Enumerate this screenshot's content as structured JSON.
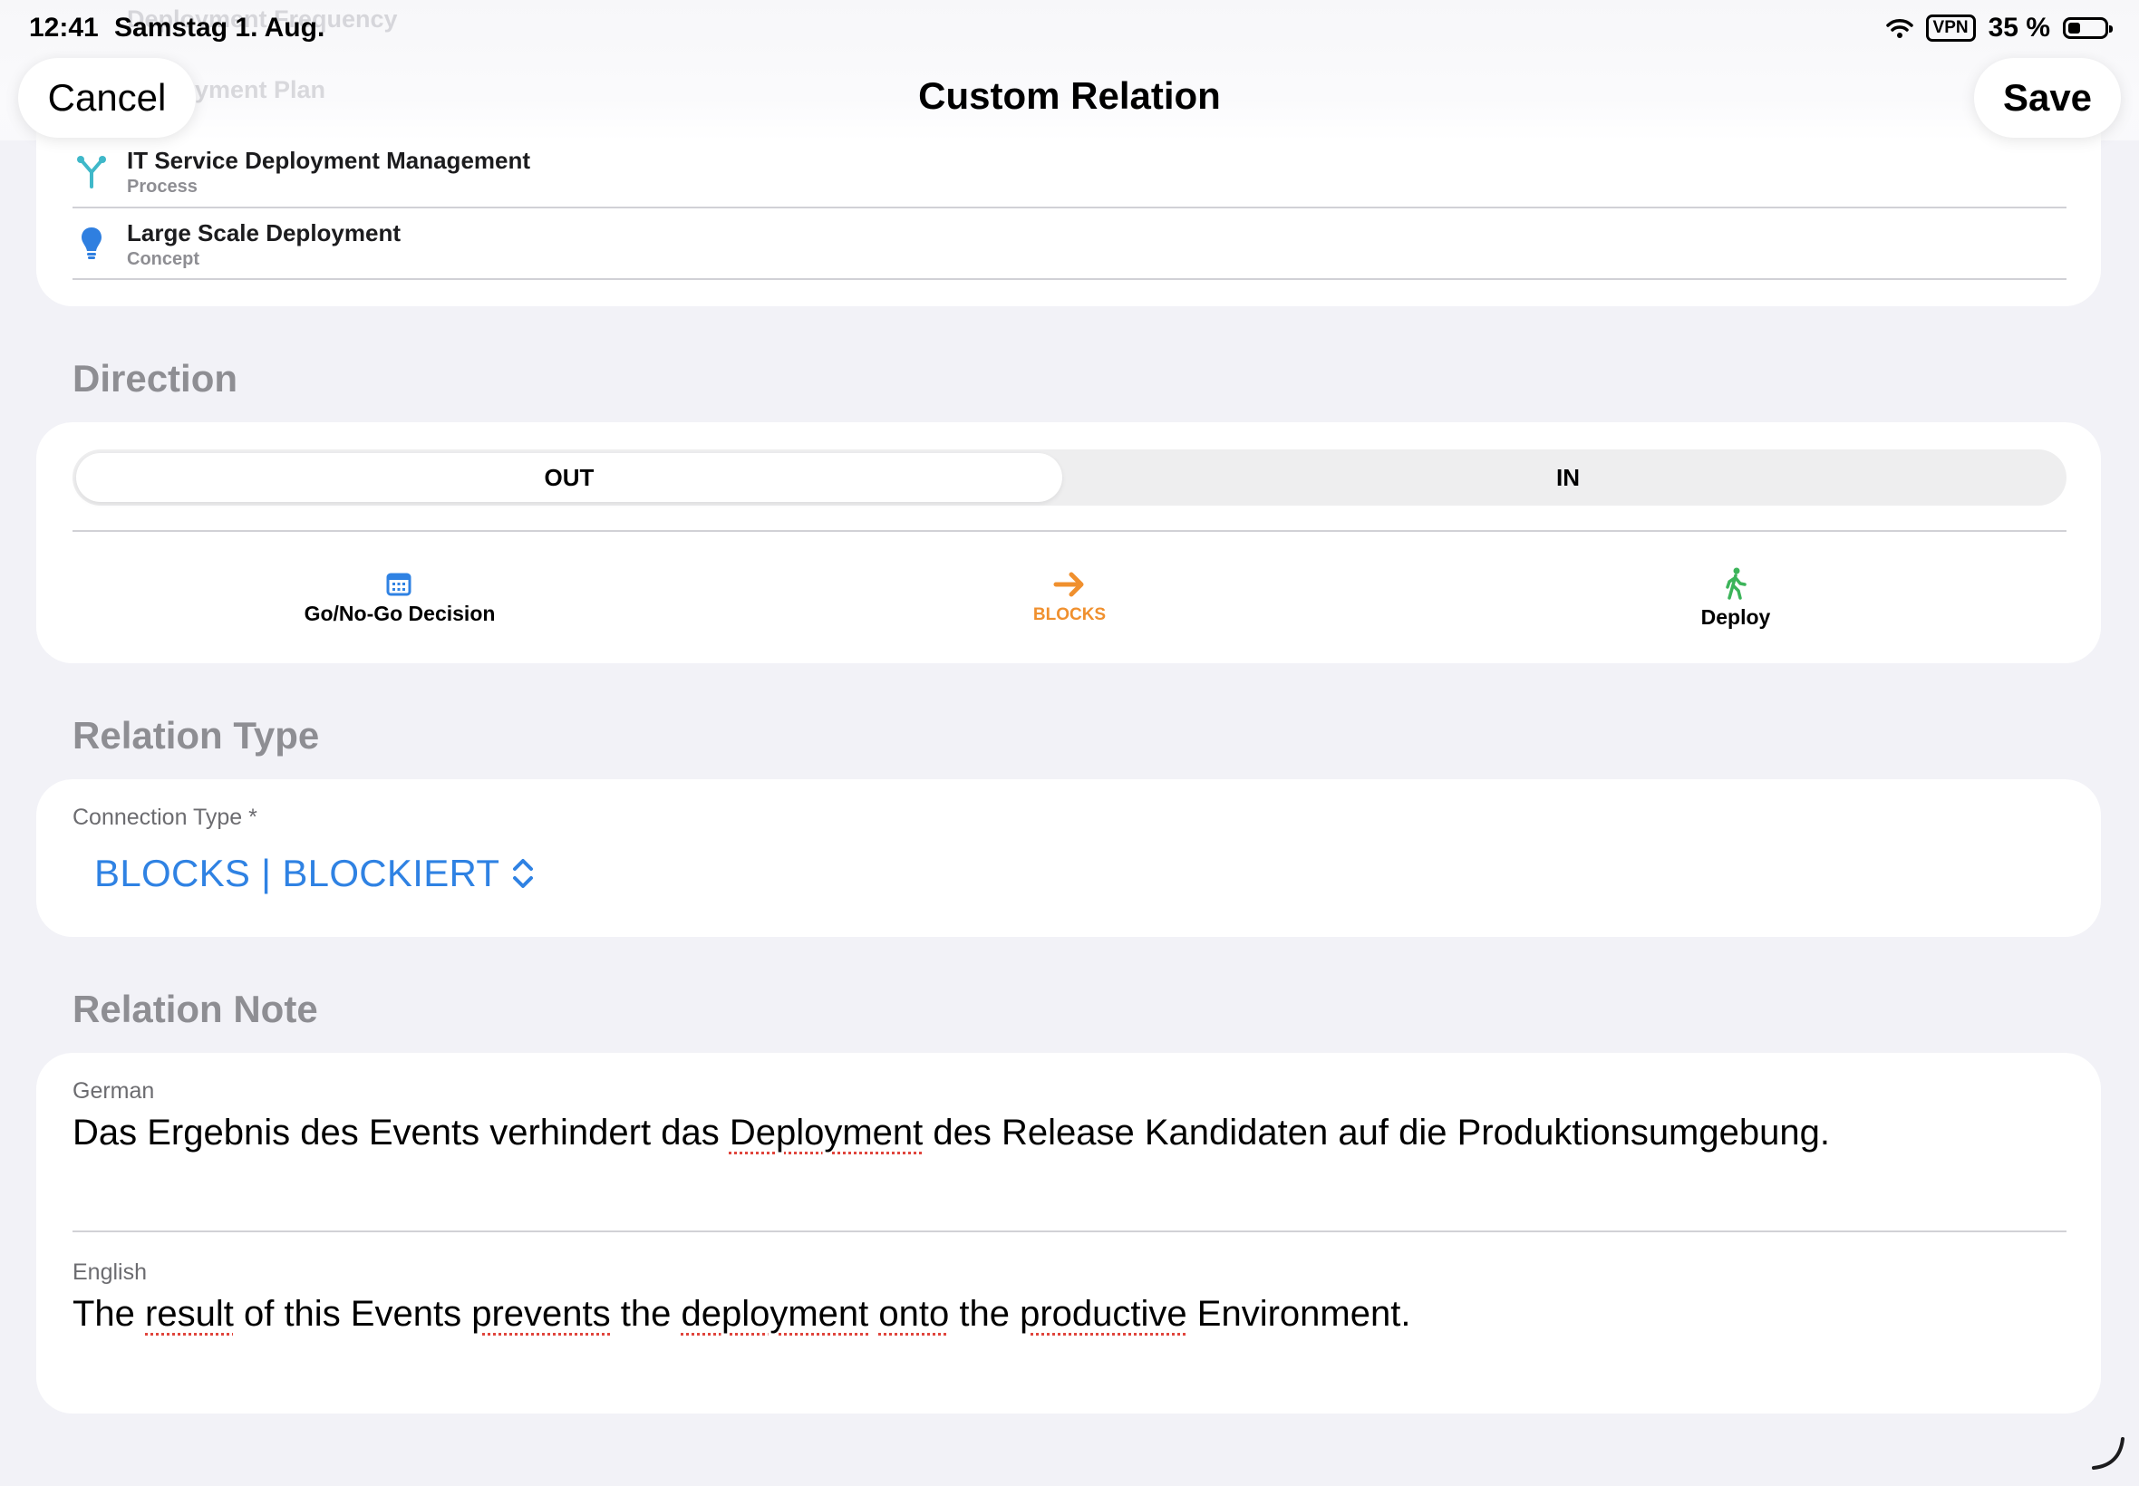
{
  "status_bar": {
    "time": "12:41",
    "date": "Samstag 1. Aug.",
    "vpn": "VPN",
    "battery": "35 %",
    "battery_level": 0.35
  },
  "nav": {
    "title": "Custom Relation",
    "cancel": "Cancel",
    "save": "Save"
  },
  "faded_rows": [
    "Deployment Frequency",
    "Deployment Plan"
  ],
  "entities": [
    {
      "title": "IT Service Deployment Management",
      "type": "Process",
      "icon": "process-branch-icon",
      "color": "#3fb8c9"
    },
    {
      "title": "Large Scale Deployment",
      "type": "Concept",
      "icon": "lightbulb-icon",
      "color": "#2f7fe0"
    }
  ],
  "direction": {
    "header": "Direction",
    "segments": [
      "OUT",
      "IN"
    ],
    "selected": "OUT",
    "from": {
      "label": "Go/No-Go Decision",
      "icon": "calendar-icon",
      "color": "#2f82e3"
    },
    "relation": {
      "label": "BLOCKS",
      "icon": "arrow-right-icon",
      "color": "#f0902e"
    },
    "to": {
      "label": "Deploy",
      "icon": "walking-person-icon",
      "color": "#3cb45a"
    }
  },
  "relation_type": {
    "header": "Relation Type",
    "field_label": "Connection Type *",
    "value": "BLOCKS | BLOCKIERT"
  },
  "relation_note": {
    "header": "Relation Note",
    "german_label": "German",
    "german": [
      "Das Ergebnis des Events verhindert das ",
      "Deployment",
      " des Release Kandidaten auf die Produktionsumgebung."
    ],
    "english_label": "English",
    "english": [
      "The ",
      "result",
      " of this Events ",
      "prevents",
      " the ",
      "deployment",
      " ",
      "onto",
      " the ",
      "productive",
      " Environment."
    ]
  },
  "colors": {
    "accent": "#2f82e3",
    "background": "#f2f2f7",
    "secondary_text": "#8e8e93"
  }
}
